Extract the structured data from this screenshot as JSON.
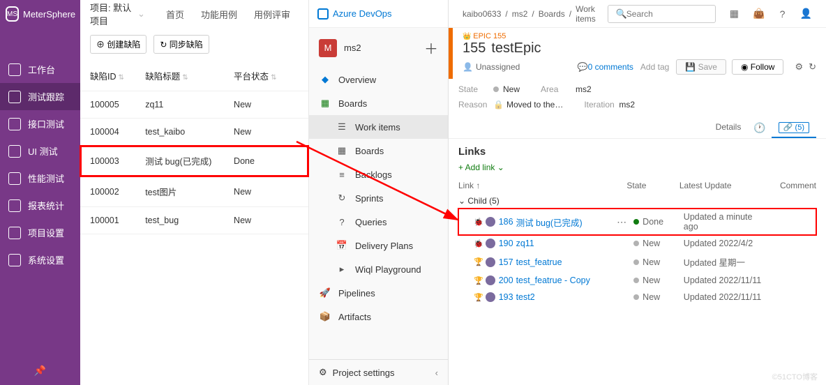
{
  "ms": {
    "logo": "MeterSphere",
    "proj_label": "项目: 默认项目",
    "top_links": [
      "首页",
      "功能用例",
      "用例评审"
    ],
    "btn_create": "创建缺陷",
    "btn_sync": "同步缺陷",
    "nav": [
      {
        "label": "工作台",
        "active": false
      },
      {
        "label": "测试跟踪",
        "active": true
      },
      {
        "label": "接口测试",
        "active": false
      },
      {
        "label": "UI 测试",
        "active": false
      },
      {
        "label": "性能测试",
        "active": false
      },
      {
        "label": "报表统计",
        "active": false
      },
      {
        "label": "项目设置",
        "active": false
      },
      {
        "label": "系统设置",
        "active": false
      }
    ],
    "cols": [
      "缺陷ID",
      "缺陷标题",
      "平台状态"
    ],
    "rows": [
      {
        "id": "100005",
        "title": "zq11",
        "status": "New",
        "hi": false
      },
      {
        "id": "100004",
        "title": "test_kaibo",
        "status": "New",
        "hi": false
      },
      {
        "id": "100003",
        "title": "测试 bug(已完成)",
        "status": "Done",
        "hi": true
      },
      {
        "id": "100002",
        "title": "test图片",
        "status": "New",
        "hi": false
      },
      {
        "id": "100001",
        "title": "test_bug",
        "status": "New",
        "hi": false
      }
    ]
  },
  "az": {
    "brand": "Azure DevOps",
    "crumbs": [
      "kaibo0633",
      "ms2",
      "Boards",
      "Work items"
    ],
    "search_ph": "Search",
    "proj_letter": "M",
    "proj_name": "ms2",
    "nav": [
      {
        "label": "Overview",
        "icon": "overview",
        "sub": false
      },
      {
        "label": "Boards",
        "icon": "boards",
        "sub": false
      },
      {
        "label": "Work items",
        "icon": "workitems",
        "sub": true,
        "sel": true
      },
      {
        "label": "Boards",
        "icon": "boards2",
        "sub": true
      },
      {
        "label": "Backlogs",
        "icon": "backlogs",
        "sub": true
      },
      {
        "label": "Sprints",
        "icon": "sprints",
        "sub": true
      },
      {
        "label": "Queries",
        "icon": "queries",
        "sub": true
      },
      {
        "label": "Delivery Plans",
        "icon": "delivery",
        "sub": true
      },
      {
        "label": "Wiql Playground",
        "icon": "wiql",
        "sub": true
      },
      {
        "label": "Pipelines",
        "icon": "pipelines",
        "sub": false
      },
      {
        "label": "Artifacts",
        "icon": "artifacts",
        "sub": false
      }
    ],
    "settings": "Project settings",
    "epic_tag": "EPIC 155",
    "item_id": "155",
    "item_title": "testEpic",
    "unassigned": "Unassigned",
    "comments": "0 comments",
    "add_tag": "Add tag",
    "save": "Save",
    "follow": "Follow",
    "fields": {
      "state_l": "State",
      "state_v": "New",
      "area_l": "Area",
      "area_v": "ms2",
      "reason_l": "Reason",
      "reason_v": "Moved to the…",
      "iter_l": "Iteration",
      "iter_v": "ms2"
    },
    "tabs": {
      "details": "Details",
      "links_badge": "(5)"
    },
    "links": {
      "header": "Links",
      "add": "+ Add link",
      "col_link": "Link ↑",
      "col_state": "State",
      "col_upd": "Latest Update",
      "col_com": "Comment",
      "child": "Child (5)",
      "rows": [
        {
          "type": "bug",
          "id": "186",
          "name": "测试 bug(已完成)",
          "state": "Done",
          "upd": "Updated a minute ago",
          "hi": true,
          "dots": true
        },
        {
          "type": "bug",
          "id": "190",
          "name": "zq11",
          "state": "New",
          "upd": "Updated 2022/4/2"
        },
        {
          "type": "feat",
          "id": "157",
          "name": "test_featrue",
          "state": "New",
          "upd": "Updated 星期一"
        },
        {
          "type": "feat",
          "id": "200",
          "name": "test_featrue - Copy",
          "state": "New",
          "upd": "Updated 2022/11/11"
        },
        {
          "type": "feat",
          "id": "193",
          "name": "test2",
          "state": "New",
          "upd": "Updated 2022/11/11"
        }
      ]
    }
  },
  "watermark": "©51CTO博客"
}
